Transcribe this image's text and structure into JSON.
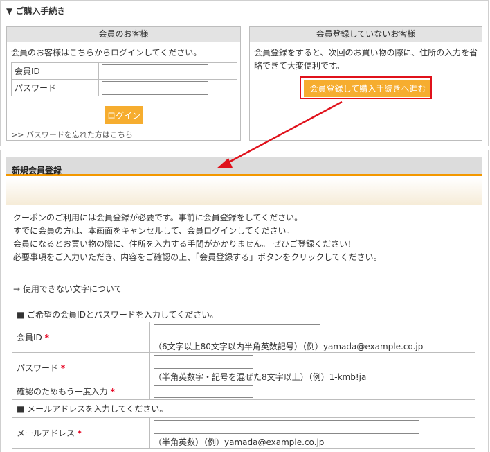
{
  "purchase": {
    "title": "▼ ご購入手続き",
    "member": {
      "heading": "会員のお客様",
      "prompt": "会員のお客様はこちらからログインしてください。",
      "id_label": "会員ID",
      "password_label": "パスワード",
      "id_value": "",
      "password_value": "",
      "login_button": "ログイン",
      "forgot_link": ">> パスワードを忘れた方はこちら"
    },
    "guest": {
      "heading": "会員登録していないお客様",
      "description_line1": "会員登録をすると、次回のお買い物の際に、住所の入力を省",
      "description_line2": "略できて大変便利です。",
      "register_button": "会員登録して購入手続きへ進む"
    }
  },
  "registration": {
    "heading": "新規会員登録",
    "intro": [
      "クーポンのご利用には会員登録が必要です。事前に会員登録をしてください。",
      "すでに会員の方は、本画面をキャンセルして、会員ログインしてください。",
      "会員になるとお買い物の際に、住所を入力する手間がかかりません。 ぜひご登録ください！",
      "必要事項をご入力いただき、内容をご確認の上、「会員登録する」ボタンをクリックしてください。"
    ],
    "invalid_chars_link": "→ 使用できない文字について",
    "required_mark": "*",
    "group1": "■ ご希望の会員IDとパスワードを入力してください。",
    "member_id_label": "会員ID",
    "member_id_hint": "（6文字以上80文字以内半角英数記号）（例）yamada@example.co.jp",
    "password_label": "パスワード",
    "password_hint": "（半角英数字・記号を混ぜた8文字以上）（例）1-kmb!ja",
    "confirm_label": "確認のためもう一度入力",
    "group2": "■ メールアドレスを入力してください。",
    "email_label": "メールアドレス",
    "email_hint": "（半角英数）（例）yamada@example.co.jp"
  },
  "colors": {
    "accent_orange": "#f6ad2f",
    "header_underline": "#f39800",
    "annotation_red": "#e0111b",
    "required_red": "#e6001f"
  }
}
